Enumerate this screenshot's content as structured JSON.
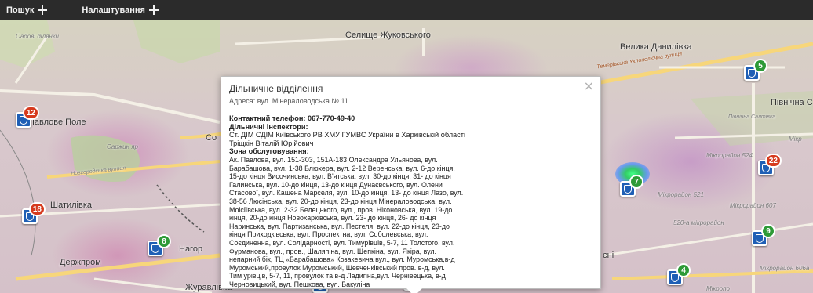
{
  "toolbar": {
    "search_label": "Пошук",
    "settings_label": "Налаштування"
  },
  "map": {
    "labels": {
      "sadovi": "Садові ділянки",
      "selyshche": "Селище Жуковського",
      "velyka": "Велика Данилівка",
      "pivnichna": "Північна С",
      "pavlove": "Павлове Поле",
      "sarzhyn": "Саржин яр",
      "shatylivka": "Шатилівка",
      "derzhprom": "Держпром",
      "zhuravlivka": "Журавлівка",
      "nahor": "Нагор",
      "sho": "Со",
      "eni": "єні",
      "mikro524": "Мікрорайон 524",
      "mikro521": "Мікрорайон 521",
      "mikro607": "Мікрорайон 607",
      "mikro5205": "520-а мікрорайон",
      "mikro606a": "Мікрорайон 606а",
      "mikropo": "Мікропо",
      "pivnichna_saltivka": "Північна Салтівка",
      "mikr": "Мікр",
      "road_top": "Темерівська Уклонолючна вулиця",
      "road_left": "Новгородська вулиця"
    },
    "markers": [
      {
        "badge": "12",
        "color": "red"
      },
      {
        "badge": "18",
        "color": "red"
      },
      {
        "badge": "8",
        "color": "green"
      },
      {
        "badge": "5",
        "color": "green"
      },
      {
        "badge": "",
        "color": ""
      },
      {
        "badge": "5",
        "color": "green"
      },
      {
        "badge": "7",
        "color": "green"
      },
      {
        "badge": "22",
        "color": "red"
      },
      {
        "badge": "9",
        "color": "green"
      },
      {
        "badge": "4",
        "color": "green"
      }
    ]
  },
  "popup": {
    "title": "Дільничне відділення",
    "address": "Адреса: вул. Мінераловодська № 11",
    "phone": "Контактний телефон: 067-770-49-40",
    "inspectors_heading": "Дільничні інспектори:",
    "inspector_1": "Ст. ДІМ СДІМ Київського РВ ХМУ ГУМВС України в Харківській області",
    "inspector_2": "Тріщкін Віталій Юрійович",
    "zone_heading": "Зона обслуговування:",
    "zone_lines": [
      "Ак. Павлова, вул. 151-303, 151А-183 Олександра Ульянова, вул.",
      "Барабашова, вул. 1-38 Блюхера, вул. 2-12 Веренська, вул. 6-до кінця,",
      "15-до кінця Височинська, вул. В'ятська, вул. 30-до кінця, 31- до кінця",
      "Галинська, вул. 10-до кінця, 13-до кінця Дунаєвського, вул. Олени",
      "Стасової, вул. Кашена Марселя, вул. 10-до кінця, 13- до кінця Лазо, вул.",
      "38-56 Люсінська, вул. 20-до кінця, 23-до кінця Мінераловодська, вул.",
      "Моісіївська, вул. 2-32 Белецького, вул., пров. Ніконовська, вул. 19-до",
      "кінця, 20-до кінця Новохарківська, вул. 23- до кінця, 26- до кінця",
      "Наринська, вул. Партизанська, вул. Пестеля, вул. 22-до кінця, 23-до",
      "кінця Приходківська, вул. Проспектна, вул. Соболевська, вул.",
      "Соєдиненна, вул. Солідарності, вул. Тимурівців, 5-7, 11 Толстого, вул.",
      "Фурманова, вул., пров., Шаляпіна, вул. Щепкіна, вул. Якіра, вул.",
      "непарний бік, ТЦ «Барабашова» Козакевича вул., вул. Муромська,в-д",
      "Муромський,провулок Муромський, Шевченківський пров.,в-д, вул.",
      "Тим урівців, 5-7, 11, провулок та в-д Ладигіна,вул. Чернівецька, в-д",
      "Черновицький, вул. Пешкова, вул. Бакуліна"
    ],
    "close_symbol": "×"
  }
}
